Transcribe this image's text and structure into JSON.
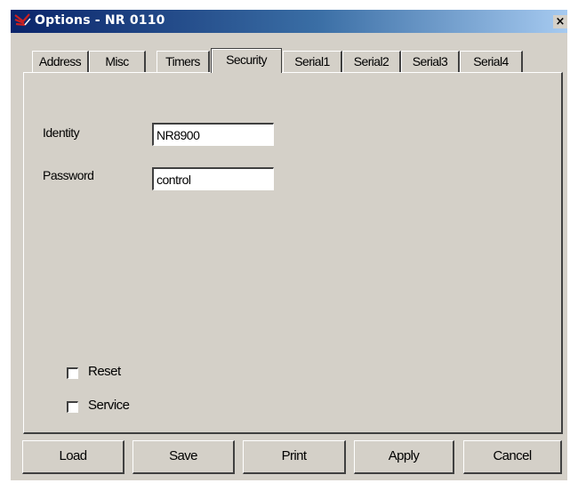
{
  "window": {
    "title": "Options - NR 0110",
    "close_glyph": "×",
    "app_icon": "network-relay-icon"
  },
  "tabs": [
    {
      "label": "Address",
      "active": false
    },
    {
      "label": "Misc",
      "active": false
    },
    {
      "label": "Timers",
      "active": false
    },
    {
      "label": "Security",
      "active": true
    },
    {
      "label": "Serial1",
      "active": false
    },
    {
      "label": "Serial2",
      "active": false
    },
    {
      "label": "Serial3",
      "active": false
    },
    {
      "label": "Serial4",
      "active": false
    }
  ],
  "security": {
    "identity_label": "Identity",
    "identity_value": "NR8900",
    "password_label": "Password",
    "password_value": "control",
    "reset_label": "Reset",
    "reset_checked": false,
    "service_label": "Service",
    "service_checked": false
  },
  "buttons": {
    "load": "Load",
    "save": "Save",
    "print": "Print",
    "apply": "Apply",
    "cancel": "Cancel"
  },
  "colors": {
    "face": "#d4d0c8",
    "title_start": "#0a246a",
    "title_end": "#a6caf0",
    "icon_accent": "#cc2020"
  }
}
